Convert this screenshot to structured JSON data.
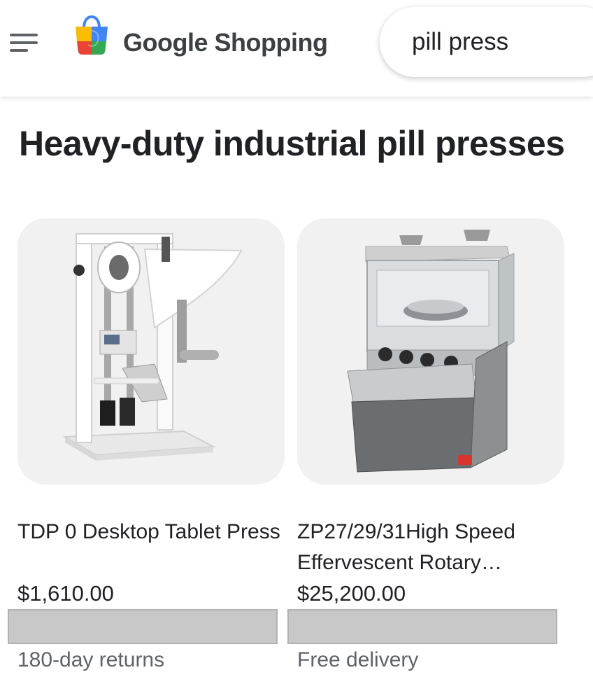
{
  "header": {
    "brand": "Google Shopping",
    "search_query": "pill press",
    "colors": {
      "brand_text": "#3c4043",
      "logo_blue": "#4285f4",
      "logo_red": "#ea4335",
      "logo_yellow": "#fbbc04",
      "logo_green": "#34a853"
    }
  },
  "section": {
    "title": "Heavy-duty industrial pill presses"
  },
  "products": [
    {
      "title": "TDP 0 Desktop Tablet Press",
      "price": "$1,610.00",
      "note": "180-day returns"
    },
    {
      "title": "ZP27/29/31High Speed Effervescent Rotary…",
      "price": "$25,200.00",
      "note": "Free delivery"
    }
  ]
}
